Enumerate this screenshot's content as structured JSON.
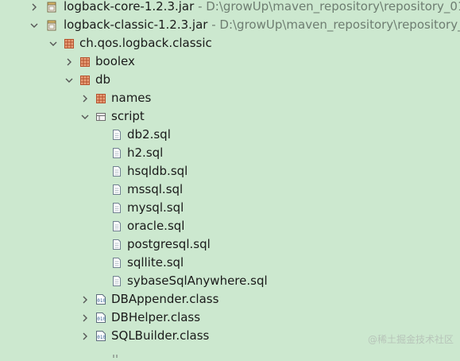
{
  "tree": {
    "core_jar": {
      "name": "logback-core-1.2.3.jar",
      "path": " - D:\\growUp\\maven_repository\\repository_01",
      "icon": "jar-icon"
    },
    "classic_jar": {
      "name": "logback-classic-1.2.3.jar",
      "path": " - D:\\growUp\\maven_repository\\repository_0",
      "icon": "jar-icon"
    },
    "pkg_classic": {
      "name": "ch.qos.logback.classic",
      "icon": "package-icon"
    },
    "pkg_boolex": {
      "name": "boolex",
      "icon": "package-icon"
    },
    "pkg_db": {
      "name": "db",
      "icon": "package-icon"
    },
    "pkg_names": {
      "name": "names",
      "icon": "package-icon"
    },
    "folder_script": {
      "name": "script",
      "icon": "folder-package-icon"
    },
    "files": [
      "db2.sql",
      "h2.sql",
      "hsqldb.sql",
      "mssql.sql",
      "mysql.sql",
      "oracle.sql",
      "postgresql.sql",
      "sqllite.sql",
      "sybaseSqlAnywhere.sql"
    ],
    "classes": [
      "DBAppender.class",
      "DBHelper.class",
      "SQLBuilder.class"
    ]
  },
  "watermark": "@稀土掘金技术社区",
  "colors": {
    "background": "#cce8cf",
    "text": "#1a1a1a",
    "path_text": "#6e7d71",
    "package_icon": "#b5512d",
    "arrow": "#555555"
  }
}
